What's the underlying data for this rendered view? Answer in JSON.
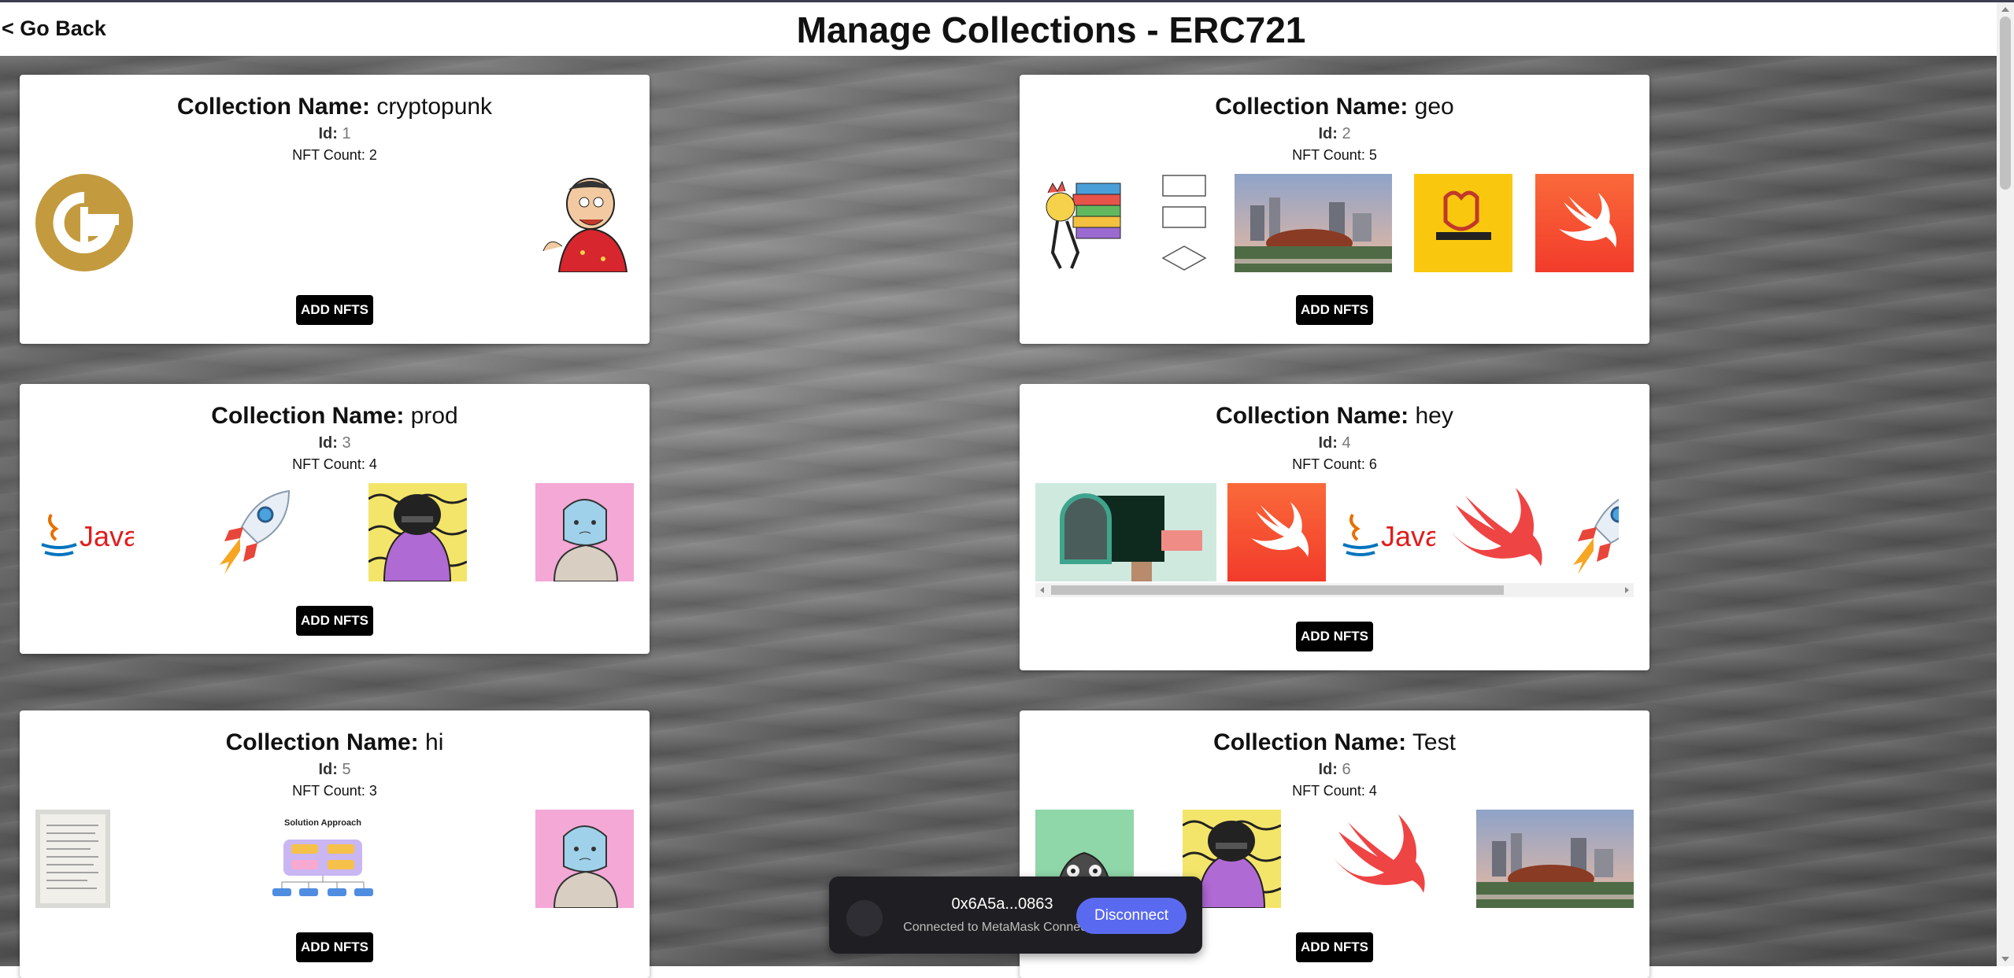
{
  "header": {
    "back_label": "< Go Back",
    "title": "Manage Collections - ERC721"
  },
  "labels": {
    "collection_name": "Collection Name:",
    "id": "Id:",
    "nft_count": "NFT Count:",
    "add_button": "ADD NFTS"
  },
  "collections": [
    {
      "name": "cryptopunk",
      "id": "1",
      "count": "2",
      "nfts": [
        "gold-coin-logo",
        "cartoon-character"
      ]
    },
    {
      "name": "geo",
      "id": "2",
      "count": "5",
      "nfts": [
        "cartoon-books",
        "flowchart-shapes",
        "city-photo",
        "yellow-logo",
        "swift-logo"
      ]
    },
    {
      "name": "prod",
      "id": "3",
      "count": "4",
      "nfts": [
        "java-logo",
        "rocket",
        "purple-character",
        "blue-character"
      ]
    },
    {
      "name": "hey",
      "id": "4",
      "count": "6",
      "nfts": [
        "mailbox",
        "swift-logo",
        "java-logo",
        "swift-bird",
        "rocket"
      ]
    },
    {
      "name": "hi",
      "id": "5",
      "count": "3",
      "nfts": [
        "document-scan",
        "solution-diagram",
        "blue-character"
      ]
    },
    {
      "name": "Test",
      "id": "6",
      "count": "4",
      "nfts": [
        "owl-character",
        "purple-character",
        "swift-bird",
        "city-photo"
      ]
    }
  ],
  "nft_text": {
    "java": "Java",
    "solution_title": "Solution Approach"
  },
  "wallet": {
    "address": "0x6A5a...0863",
    "connection": "Connected to MetaMask Connector",
    "disconnect_label": "Disconnect"
  },
  "colors": {
    "button": "#000000",
    "disconnect": "#5a6af0",
    "wallet_bg": "#1f1f23",
    "swift_orange": "#f05138",
    "java_red": "#e76f00"
  }
}
